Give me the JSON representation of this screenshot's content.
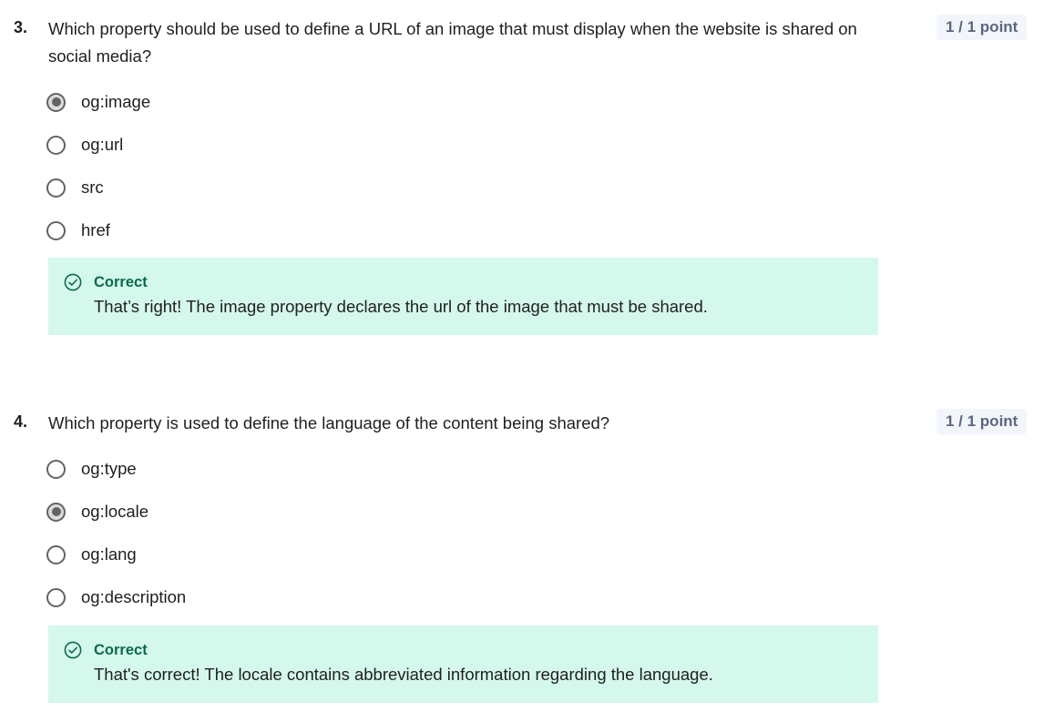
{
  "questions": [
    {
      "number": "3.",
      "text": "Which property should be used to define a URL of an image that must display when the website is shared on social media?",
      "points": "1 / 1 point",
      "options": [
        {
          "label": "og:image",
          "selected": true
        },
        {
          "label": "og:url",
          "selected": false
        },
        {
          "label": "src",
          "selected": false
        },
        {
          "label": "href",
          "selected": false
        }
      ],
      "feedback": {
        "icon": "check-circle-icon",
        "title": "Correct",
        "text": "That’s right! The image property declares the url of the image that must be shared."
      }
    },
    {
      "number": "4.",
      "text": "Which property is used to define the language of the content being shared?",
      "points": "1 / 1 point",
      "options": [
        {
          "label": "og:type",
          "selected": false
        },
        {
          "label": "og:locale",
          "selected": true
        },
        {
          "label": "og:lang",
          "selected": false
        },
        {
          "label": "og:description",
          "selected": false
        }
      ],
      "feedback": {
        "icon": "check-circle-icon",
        "title": "Correct",
        "text": "That's correct! The locale contains abbreviated information regarding the language."
      }
    }
  ],
  "colors": {
    "feedback_bg": "#d4f8ec",
    "feedback_title": "#0b6b4b",
    "badge_bg": "#f2f5fa",
    "badge_text": "#5b6780",
    "radio": "#636363"
  }
}
